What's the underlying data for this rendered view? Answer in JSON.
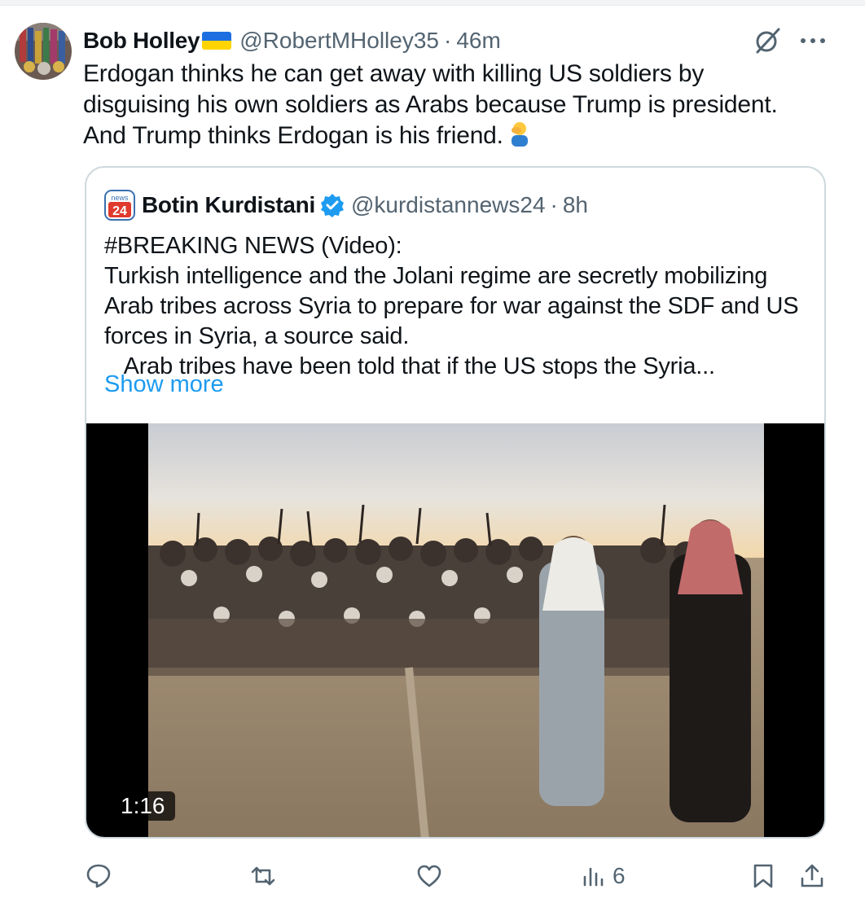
{
  "tweet": {
    "author_name": "Bob Holley",
    "author_handle": "@RobertMHolley35",
    "separator": "·",
    "time": "46m",
    "text": "Erdogan thinks he can get away with killing US soldiers by disguising his own soldiers as Arabs because Trump is president. And Trump thinks Erdogan is his friend.",
    "emoji": "🤦‍♂️"
  },
  "quoted": {
    "logo_text_top": "news",
    "logo_text_num": "24",
    "author_name": "Botin Kurdistani",
    "author_handle": "@kurdistannews24",
    "separator": "·",
    "time": "8h",
    "text": "#BREAKING NEWS (Video):\nTurkish intelligence and the Jolani regime are secretly mobilizing Arab tribes across Syria to prepare for war against the SDF and US forces in Syria, a source said.\n   Arab tribes have been told that if the US stops the Syria...",
    "show_more": "Show more",
    "video_duration": "1:16"
  },
  "actions": {
    "reply_count": "",
    "retweet_count": "",
    "like_count": "",
    "views_count": "6"
  },
  "colors": {
    "text": "#0f1419",
    "secondary": "#536471",
    "link": "#1d9bf0",
    "verified": "#1d9bf0",
    "flag_blue": "#1d6fe0",
    "flag_yellow": "#ffd400"
  }
}
